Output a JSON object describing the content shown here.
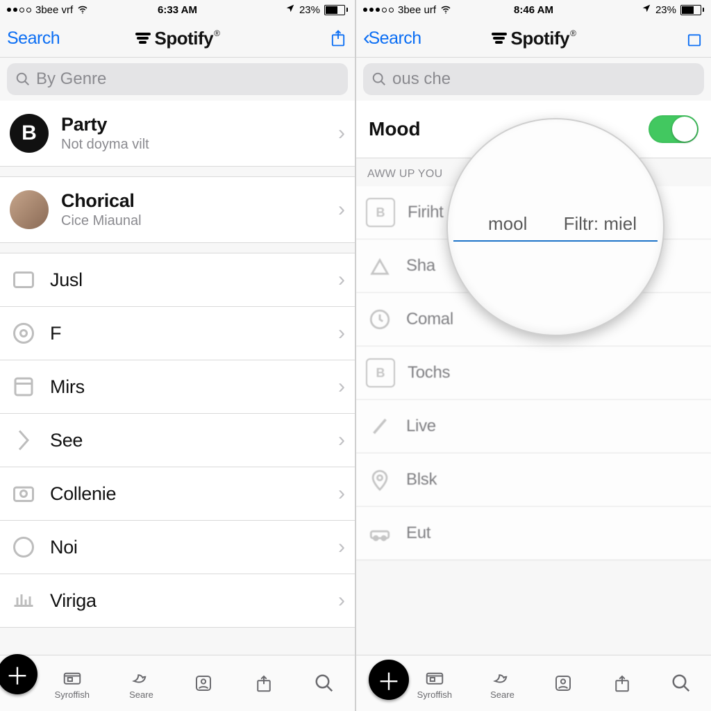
{
  "left": {
    "status": {
      "carrier": "3bee vrf",
      "time": "6:33 AM",
      "battery": "23%"
    },
    "nav": {
      "back": "Search",
      "title": "Spotify"
    },
    "search": {
      "placeholder": "By Genre"
    },
    "featured": [
      {
        "title": "Party",
        "subtitle": "Not doyma vilt",
        "iconText": "B"
      },
      {
        "title": "Chorical",
        "subtitle": "Cice Miaunal",
        "avatar": true
      }
    ],
    "items": [
      {
        "title": "Jusl"
      },
      {
        "title": "F"
      },
      {
        "title": "Mirs"
      },
      {
        "title": "See"
      },
      {
        "title": "Collenie"
      },
      {
        "title": "Noi"
      },
      {
        "title": "Viriga"
      }
    ]
  },
  "right": {
    "status": {
      "carrier": "3bee urf",
      "time": "8:46 AM",
      "battery": "23%"
    },
    "nav": {
      "back": "Search",
      "title": "Spotify"
    },
    "search": {
      "placeholder": "ous che"
    },
    "mood": {
      "label": "Mood",
      "on": true
    },
    "section": "AWW UP YOU",
    "items": [
      {
        "title": "Firiht",
        "glyph": "B"
      },
      {
        "title": "Sha",
        "glyph": "peak"
      },
      {
        "title": "Comal",
        "glyph": "clock"
      },
      {
        "title": "Tochs",
        "glyph": "Bsq"
      },
      {
        "title": "Live",
        "glyph": "slash"
      },
      {
        "title": "Blsk",
        "glyph": "pin"
      },
      {
        "title": "Eut",
        "glyph": "car"
      }
    ],
    "lens": {
      "left": "mool",
      "right": "Filtr: miel"
    }
  },
  "tabs": [
    {
      "label": "Syroffish"
    },
    {
      "label": "Seare"
    },
    {
      "label": ""
    },
    {
      "label": ""
    },
    {
      "label": ""
    }
  ]
}
